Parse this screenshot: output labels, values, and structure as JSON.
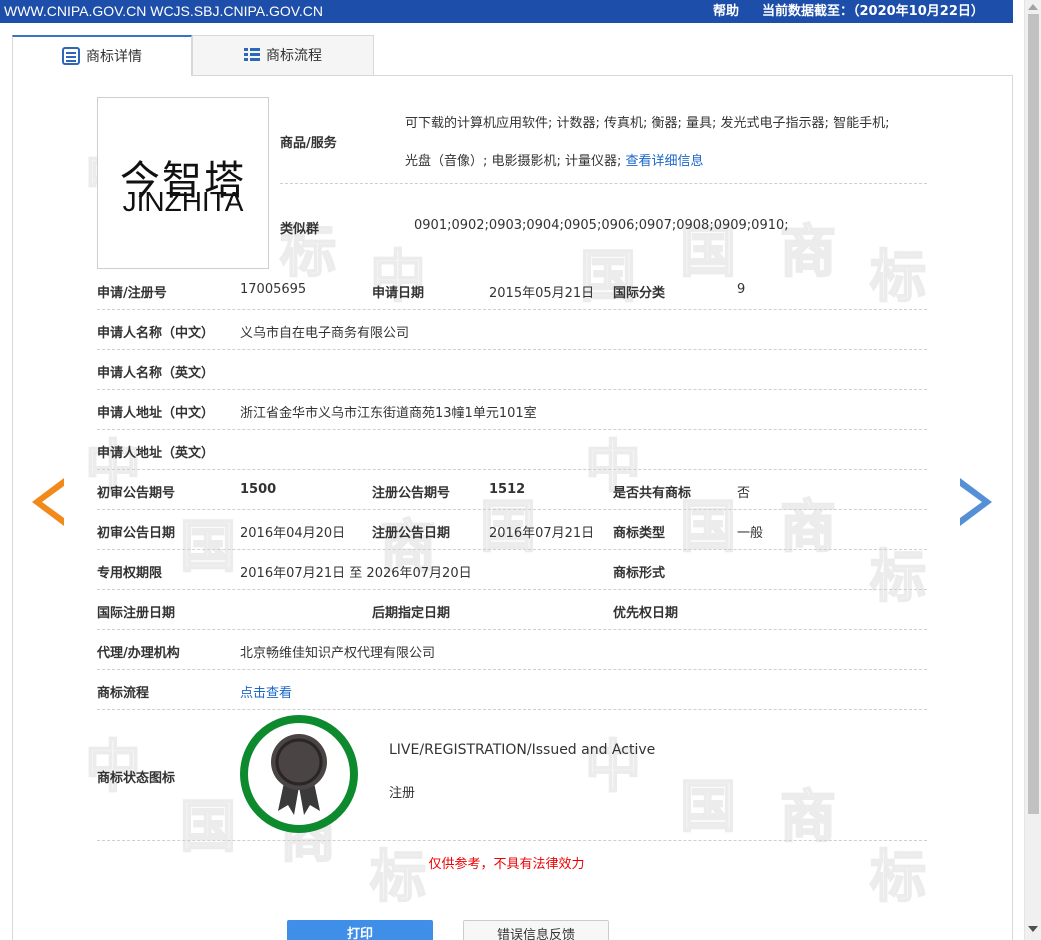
{
  "topbar": {
    "sites": "WWW.CNIPA.GOV.CN WCJS.SBJ.CNIPA.GOV.CN",
    "help": "帮助",
    "as_of": "当前数据截至：（2020年10月22日）"
  },
  "tabs": [
    {
      "label": "商标详情",
      "icon": "document-list-icon",
      "active": true
    },
    {
      "label": "商标流程",
      "icon": "list-icon",
      "active": false
    }
  ],
  "watermark_text": [
    "中",
    "国",
    "商",
    "标"
  ],
  "trademark": {
    "logo_cn": "今智塔",
    "logo_en": "JINZHITA"
  },
  "goods": {
    "label": "商品/服务",
    "line1": "可下载的计算机应用软件; 计数器; 传真机; 衡器; 量具; 发光式电子指示器; 智能手机;",
    "line2": "光盘（音像）; 电影摄影机; 计量仪器;",
    "more_link": "查看详细信息"
  },
  "similar_groups": {
    "label": "类似群",
    "value": "0901;0902;0903;0904;0905;0906;0907;0908;0909;0910;"
  },
  "fields": {
    "reg_no_label": "申请/注册号",
    "reg_no": "17005695",
    "app_date_label": "申请日期",
    "app_date": "2015年05月21日",
    "intl_class_label": "国际分类",
    "intl_class": "9",
    "applicant_cn_label": "申请人名称（中文）",
    "applicant_cn": "义乌市自在电子商务有限公司",
    "applicant_en_label": "申请人名称（英文）",
    "applicant_en": "",
    "address_cn_label": "申请人地址（中文）",
    "address_cn": "浙江省金华市义乌市江东街道商苑13幢1单元101室",
    "address_en_label": "申请人地址（英文）",
    "address_en": "",
    "prelim_pub_no_label": "初审公告期号",
    "prelim_pub_no": "1500",
    "reg_pub_no_label": "注册公告期号",
    "reg_pub_no": "1512",
    "shared_label": "是否共有商标",
    "shared": "否",
    "prelim_pub_date_label": "初审公告日期",
    "prelim_pub_date": "2016年04月20日",
    "reg_pub_date_label": "注册公告日期",
    "reg_pub_date": "2016年07月21日",
    "tm_type_label": "商标类型",
    "tm_type": "一般",
    "exclusive_label": "专用权期限",
    "exclusive": "2016年07月21日 至 2026年07月20日",
    "tm_form_label": "商标形式",
    "tm_form": "",
    "intl_reg_date_label": "国际注册日期",
    "later_designation_label": "后期指定日期",
    "priority_date_label": "优先权日期",
    "agent_label": "代理/办理机构",
    "agent": "北京畅维佳知识产权代理有限公司",
    "process_label": "商标流程",
    "process_link": "点击查看",
    "status_icon_label": "商标状态图标",
    "status_en": "LIVE/REGISTRATION/Issued and Active",
    "status_cn": "注册"
  },
  "notice": "仅供参考，不具有法律效力",
  "buttons": {
    "print": "打印",
    "feedback": "错误信息反馈"
  },
  "colors": {
    "topbar": "#1c4eaa",
    "link": "#1b66c9",
    "prev_arrow": "#f18a1b",
    "next_arrow": "#5590d6",
    "badge_ring": "#0d8a2e",
    "notice": "#ee0000",
    "print_button": "#3f8ee8"
  }
}
